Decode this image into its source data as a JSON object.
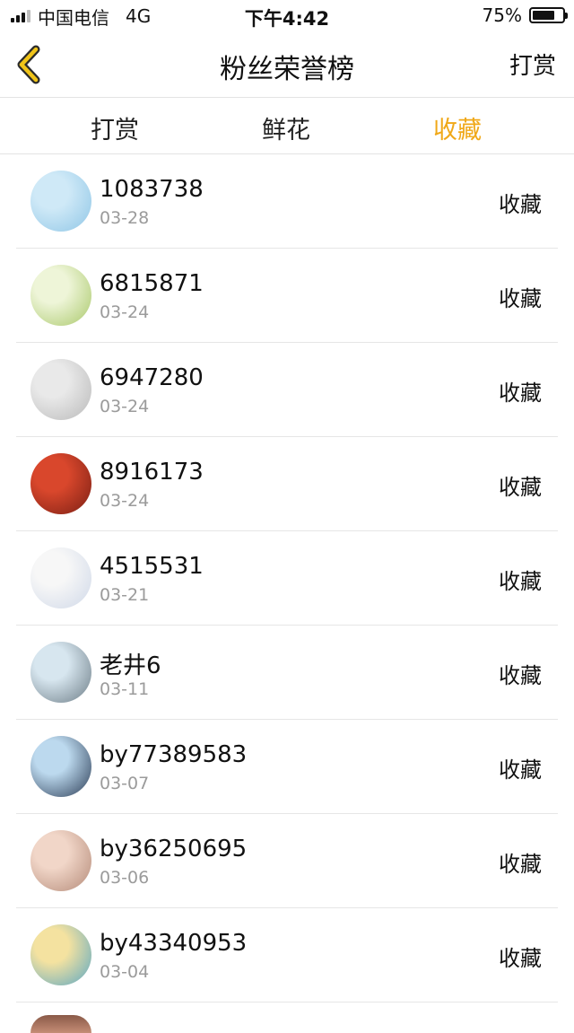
{
  "status_bar": {
    "carrier": "中国电信",
    "network": "4G",
    "time": "下午4:42",
    "battery": "75%",
    "battery_level": 0.75
  },
  "nav": {
    "title": "粉丝荣誉榜",
    "action_label": "打赏",
    "back_icon": "chevron-left-icon",
    "accent_color": "#f0c419"
  },
  "tabs": [
    {
      "label": "打赏",
      "active": false
    },
    {
      "label": "鲜花",
      "active": false
    },
    {
      "label": "收藏",
      "active": true
    }
  ],
  "colors": {
    "active_tab": "#f0a818",
    "date_text": "#9b9b9b",
    "divider": "#e6e6e6"
  },
  "fans": [
    {
      "name": "1083738",
      "date": "03-28",
      "action": "收藏",
      "avatar": "avatar-blue-snowflake",
      "avatar_colors": [
        "#cfe9f7",
        "#8fc6e6"
      ]
    },
    {
      "name": "6815871",
      "date": "03-24",
      "action": "收藏",
      "avatar": "avatar-cartoon-twins",
      "avatar_colors": [
        "#eef5d8",
        "#a9c86a"
      ]
    },
    {
      "name": "6947280",
      "date": "03-24",
      "action": "收藏",
      "avatar": "avatar-plush-toy",
      "avatar_colors": [
        "#e9e9e9",
        "#b9b9b9"
      ]
    },
    {
      "name": "8916173",
      "date": "03-24",
      "action": "收藏",
      "avatar": "avatar-girl-red",
      "avatar_colors": [
        "#d9472c",
        "#7a1f14"
      ]
    },
    {
      "name": "4515531",
      "date": "03-21",
      "action": "收藏",
      "avatar": "avatar-text-note",
      "avatar_colors": [
        "#f7f7f7",
        "#cfd8e8"
      ]
    },
    {
      "name": "老井6",
      "date": "03-11",
      "action": "收藏",
      "avatar": "avatar-landscape",
      "avatar_colors": [
        "#d7e6ef",
        "#6c7c86"
      ]
    },
    {
      "name": "by77389583",
      "date": "03-07",
      "action": "收藏",
      "avatar": "avatar-girl-blue",
      "avatar_colors": [
        "#bcd9ee",
        "#2b3c55"
      ]
    },
    {
      "name": "by36250695",
      "date": "03-06",
      "action": "收藏",
      "avatar": "avatar-two-girls",
      "avatar_colors": [
        "#f1d6c8",
        "#b48a78"
      ]
    },
    {
      "name": "by43340953",
      "date": "03-04",
      "action": "收藏",
      "avatar": "avatar-stitch-case",
      "avatar_colors": [
        "#f4e2a0",
        "#5aa7c4"
      ]
    }
  ]
}
